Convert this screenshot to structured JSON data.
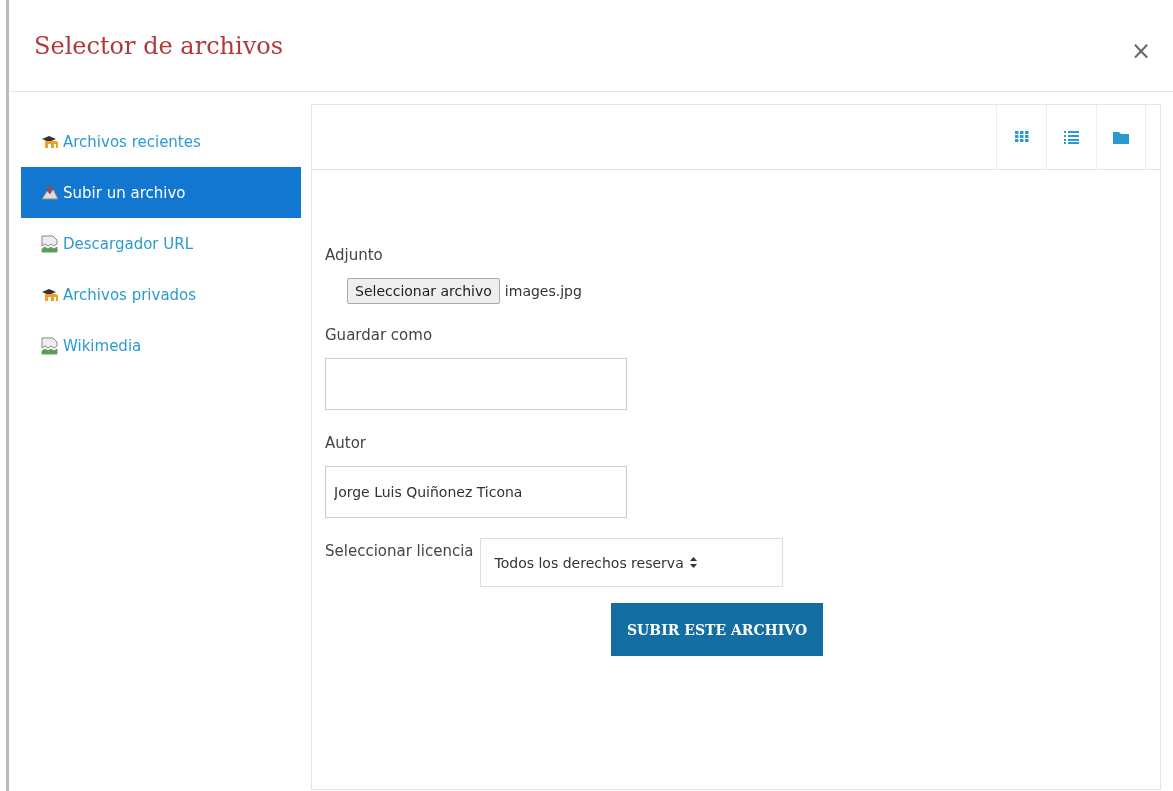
{
  "dialog": {
    "title": "Selector de archivos",
    "close": "×"
  },
  "sidebar": {
    "items": [
      {
        "label": "Archivos recientes",
        "kind": "repository",
        "selected": false
      },
      {
        "label": "Subir un archivo",
        "kind": "upload",
        "selected": true
      },
      {
        "label": "Descargador URL",
        "kind": "broken-image",
        "selected": false
      },
      {
        "label": "Archivos privados",
        "kind": "repository",
        "selected": false
      },
      {
        "label": "Wikimedia",
        "kind": "broken-image",
        "selected": false
      }
    ]
  },
  "toolbar": {
    "views": [
      {
        "kind": "grid"
      },
      {
        "kind": "list"
      },
      {
        "kind": "folder"
      }
    ]
  },
  "form": {
    "attachment": {
      "label": "Adjunto",
      "button": "Seleccionar archivo",
      "file": "images.jpg"
    },
    "save_as": {
      "label": "Guardar como"
    },
    "author": {
      "label": "Autor",
      "value": "Jorge Luis Quiñonez Ticona"
    },
    "license": {
      "label": "Seleccionar licencia",
      "value": "Todos los derechos reserva"
    },
    "submit": "SUBIR ESTE ARCHIVO"
  }
}
